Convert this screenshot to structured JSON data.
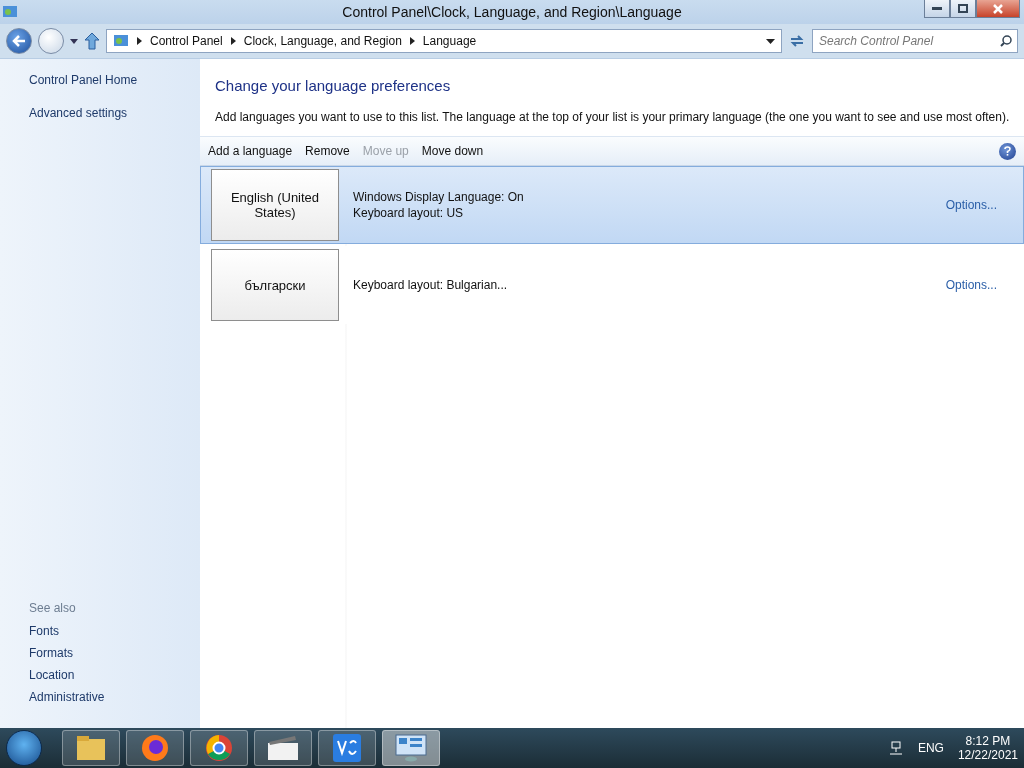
{
  "window": {
    "title": "Control Panel\\Clock, Language, and Region\\Language"
  },
  "address_bar": {
    "crumbs": [
      "Control Panel",
      "Clock, Language, and Region",
      "Language"
    ],
    "search": {
      "placeholder": "Search Control Panel"
    }
  },
  "sidebar": {
    "items": [
      "Control Panel Home",
      "Advanced settings"
    ],
    "see_also": {
      "heading": "See also",
      "items": [
        "Fonts",
        "Formats",
        "Location",
        "Administrative"
      ]
    }
  },
  "main": {
    "heading": "Change your language preferences",
    "description": "Add languages you want to use to this list. The language at the top of your list is your primary language (the one you want to see and use most often).",
    "toolbar": [
      {
        "label": "Add a language",
        "disabled": false
      },
      {
        "label": "Remove",
        "disabled": false
      },
      {
        "label": "Move up",
        "disabled": true
      },
      {
        "label": "Move down",
        "disabled": false
      }
    ],
    "languages": [
      {
        "name": "English (United States)",
        "details": [
          "Windows Display Language: On",
          "Keyboard layout: US"
        ],
        "options": "Options...",
        "selected": true
      },
      {
        "name": "български",
        "details": [
          "Keyboard layout: Bulgarian..."
        ],
        "options": "Options...",
        "selected": false
      }
    ]
  },
  "taskbar": {
    "apps": [
      {
        "kind": "explorer"
      },
      {
        "kind": "firefox"
      },
      {
        "kind": "chrome"
      },
      {
        "kind": "media"
      },
      {
        "kind": "vnc"
      },
      {
        "kind": "control",
        "selected": true
      }
    ],
    "tray": {
      "language": "ENG",
      "time": "8:12 PM",
      "date": "12/22/2021"
    }
  }
}
